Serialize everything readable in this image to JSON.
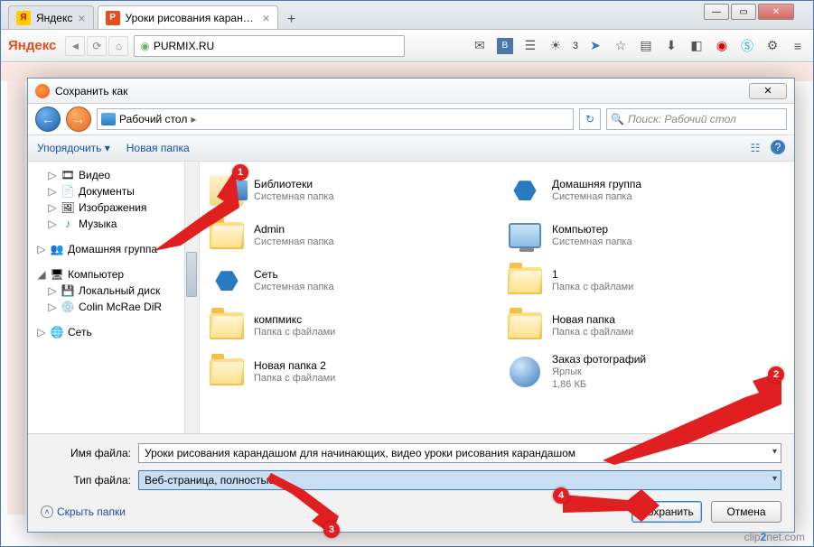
{
  "browser": {
    "tabs": [
      {
        "title": "Яндекс",
        "icon": "y"
      },
      {
        "title": "Уроки рисования каранда...",
        "icon": "p"
      }
    ],
    "logo": "Яндекс",
    "url": "PURMIX.RU",
    "weather": "3",
    "win": {
      "min": "—",
      "max": "▭",
      "close": "✕"
    }
  },
  "dialog": {
    "title": "Сохранить как",
    "breadcrumb": "Рабочий стол",
    "breadcrumb_sep": "▸",
    "search_placeholder": "Поиск: Рабочий стол",
    "organize": "Упорядочить ▾",
    "new_folder": "Новая папка",
    "tree": {
      "video": "Видео",
      "documents": "Документы",
      "images": "Изображения",
      "music": "Музыка",
      "homegroup": "Домашняя группа",
      "computer": "Компьютер",
      "localdisk": "Локальный диск",
      "colin": "Colin McRae DiR",
      "network": "Сеть"
    },
    "files": [
      {
        "name": "Библиотеки",
        "sub": "Системная папка",
        "icon": "lib"
      },
      {
        "name": "Домашняя группа",
        "sub": "Системная папка",
        "icon": "net"
      },
      {
        "name": "Admin",
        "sub": "Системная папка",
        "icon": "folder"
      },
      {
        "name": "Компьютер",
        "sub": "Системная папка",
        "icon": "comp"
      },
      {
        "name": "Сеть",
        "sub": "Системная папка",
        "icon": "net"
      },
      {
        "name": "1",
        "sub": "Папка с файлами",
        "icon": "folder"
      },
      {
        "name": "компмикс",
        "sub": "Папка с файлами",
        "icon": "folder"
      },
      {
        "name": "Новая папка",
        "sub": "Папка с файлами",
        "icon": "folder"
      },
      {
        "name": "Новая папка 2",
        "sub": "Папка с файлами",
        "icon": "folder"
      },
      {
        "name": "Заказ фотографий",
        "sub": "Ярлык\n1,86 КБ",
        "icon": "globe"
      }
    ],
    "filename_label": "Имя файла:",
    "filename_value": "Уроки рисования карандашом для начинающих, видео уроки рисования карандашом",
    "filetype_label": "Тип файла:",
    "filetype_value": "Веб-страница, полностью",
    "hide_folders": "Скрыть папки",
    "save": "Сохранить",
    "cancel": "Отмена"
  },
  "markers": {
    "m1": "1",
    "m2": "2",
    "m3": "3",
    "m4": "4"
  },
  "watermark": {
    "a": "clip",
    "b": "2",
    "c": "net",
    "d": ".com"
  }
}
